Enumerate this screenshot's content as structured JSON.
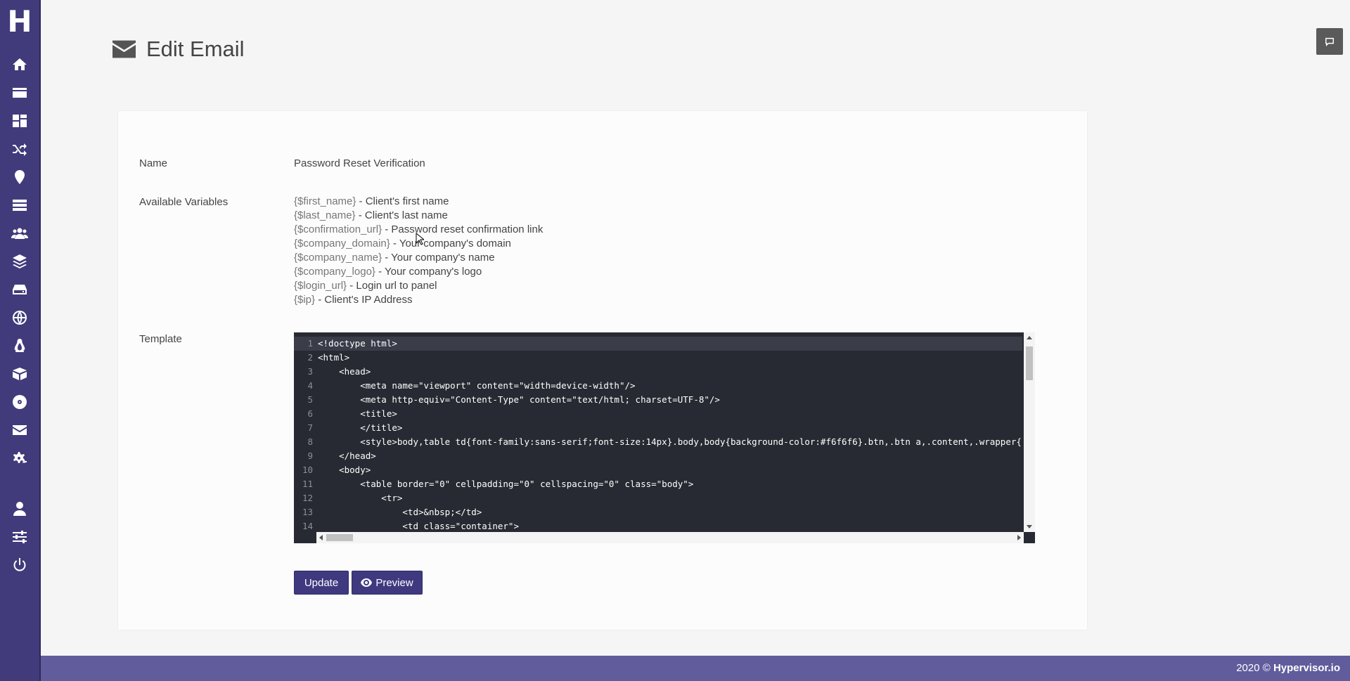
{
  "app": {
    "logo_letter": "H"
  },
  "sidebar": {
    "items": [
      {
        "icon": "home-icon"
      },
      {
        "icon": "credit-card-icon"
      },
      {
        "icon": "dashboard-grid-icon"
      },
      {
        "icon": "shuffle-icon"
      },
      {
        "icon": "location-pin-icon"
      },
      {
        "icon": "server-icon"
      },
      {
        "icon": "users-icon"
      },
      {
        "icon": "layers-icon"
      },
      {
        "icon": "hard-drive-icon"
      },
      {
        "icon": "globe-icon"
      },
      {
        "icon": "linux-icon"
      },
      {
        "icon": "boxes-icon"
      },
      {
        "icon": "disc-icon"
      },
      {
        "icon": "envelope-icon"
      },
      {
        "icon": "cogs-icon"
      },
      {
        "icon": "user-icon"
      },
      {
        "icon": "sliders-icon"
      },
      {
        "icon": "power-icon"
      }
    ]
  },
  "header": {
    "icon": "envelope-icon",
    "title": "Edit Email"
  },
  "form": {
    "name_label": "Name",
    "name_value": "Password Reset Verification",
    "vars_label": "Available Variables",
    "variables": [
      {
        "name": "{$first_name}",
        "desc": " - Client's first name"
      },
      {
        "name": "{$last_name}",
        "desc": " - Client's last name"
      },
      {
        "name": "{$confirmation_url}",
        "desc": " - Password reset confirmation link"
      },
      {
        "name": "{$company_domain}",
        "desc": " - Your company's domain"
      },
      {
        "name": "{$company_name}",
        "desc": " - Your company's name"
      },
      {
        "name": "{$company_logo}",
        "desc": " - Your company's logo"
      },
      {
        "name": "{$login_url}",
        "desc": " - Login url to panel"
      },
      {
        "name": "{$ip}",
        "desc": " - Client's IP Address"
      }
    ],
    "template_label": "Template"
  },
  "editor": {
    "lines": [
      "<!doctype html>",
      "<html>",
      "    <head>",
      "        <meta name=\"viewport\" content=\"width=device-width\"/>",
      "        <meta http-equiv=\"Content-Type\" content=\"text/html; charset=UTF-8\"/>",
      "        <title>",
      "        </title>",
      "        <style>body,table td{font-family:sans-serif;font-size:14px}.body,body{background-color:#f6f6f6}.btn,.btn a,.content,.wrapper{",
      "    </head>",
      "    <body>",
      "        <table border=\"0\" cellpadding=\"0\" cellspacing=\"0\" class=\"body\">",
      "            <tr>",
      "                <td>&nbsp;</td>",
      "                <td class=\"container\">",
      ""
    ]
  },
  "buttons": {
    "update": "Update",
    "preview": "Preview"
  },
  "footer": {
    "year": "2020 © ",
    "brand": "Hypervisor.io"
  },
  "colors": {
    "sidebar": "#413b7c",
    "footer": "#615c9c",
    "button": "#3f3a7f",
    "editor_bg": "#272a32"
  }
}
